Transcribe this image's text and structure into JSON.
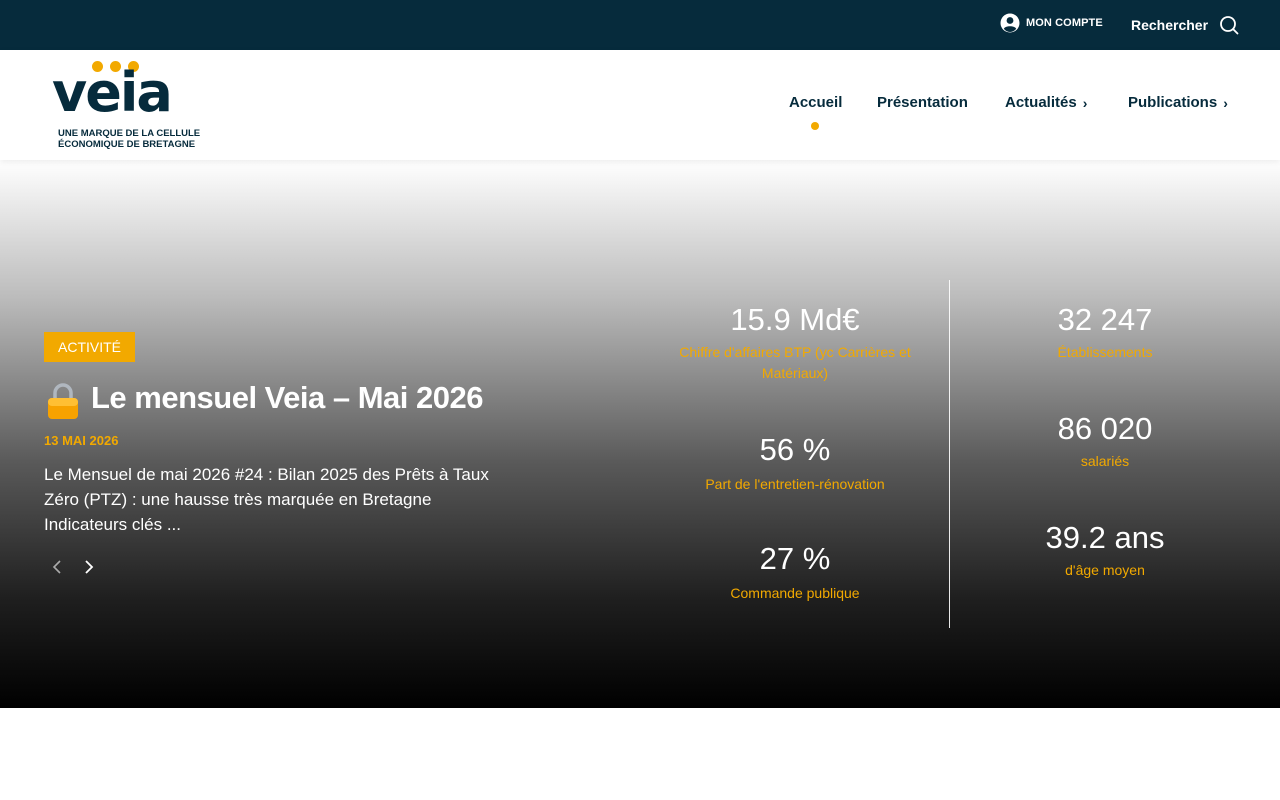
{
  "topbar": {
    "account_label": "MON COMPTE",
    "search_label": "Rechercher"
  },
  "logo": {
    "word": "veia",
    "tagline_line1": "UNE MARQUE DE LA CELLULE",
    "tagline_line2": "ÉCONOMIQUE DE BRETAGNE"
  },
  "nav": {
    "items": [
      {
        "label": "Accueil",
        "active": true
      },
      {
        "label": "Présentation"
      },
      {
        "label": "Actualités",
        "has_submenu": true
      },
      {
        "label": "Publications",
        "has_submenu": true
      }
    ]
  },
  "hero": {
    "category": "ACTIVITÉ",
    "title": "Le mensuel Veia – Mai 2026",
    "date": "13 MAI 2026",
    "excerpt_lines": [
      "Le Mensuel de mai 2026 #24 : Bilan 2025 des Prêts à Taux",
      "Zéro (PTZ) : une hausse très marquée en Bretagne",
      "Indicateurs clés ..."
    ]
  },
  "stats": {
    "left": [
      {
        "value": "15.9 Md€",
        "label": "Chiffre d'affaires BTP (yc Carrières et Matériaux)"
      },
      {
        "value": "56 %",
        "label": "Part de l'entretien-rénovation"
      },
      {
        "value": "27 %",
        "label": "Commande publique"
      }
    ],
    "right": [
      {
        "value": "32 247",
        "label": "Établissements"
      },
      {
        "value": "86 020",
        "label": "salariés"
      },
      {
        "value": "39.2 ans",
        "label": "d'âge moyen"
      }
    ]
  },
  "colors": {
    "navy": "#062b3c",
    "accent": "#f2a900",
    "white": "#ffffff"
  }
}
